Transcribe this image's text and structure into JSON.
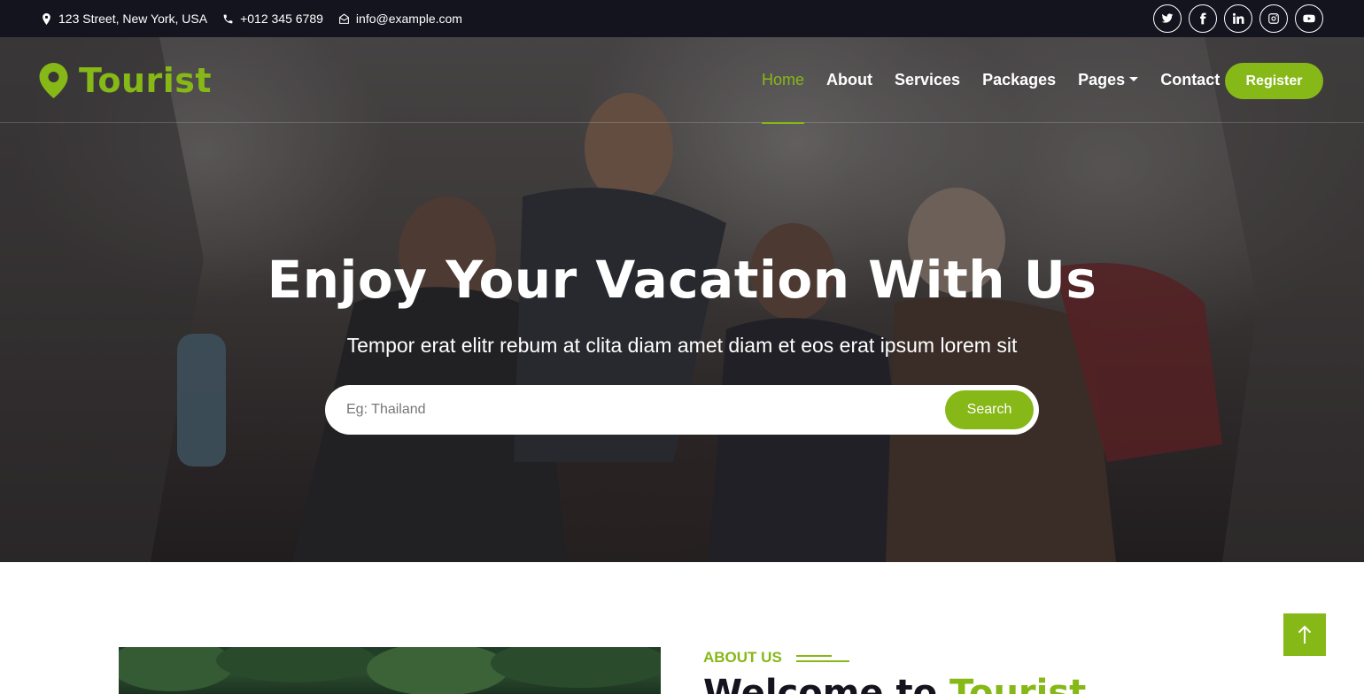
{
  "topbar": {
    "address": "123 Street, New York, USA",
    "phone": "+012 345 6789",
    "email": "info@example.com",
    "socials": [
      "twitter-icon",
      "facebook-icon",
      "linkedin-icon",
      "instagram-icon",
      "youtube-icon"
    ]
  },
  "brand": {
    "name": "Tourist",
    "icon": "map-marker-icon"
  },
  "nav": {
    "items": [
      {
        "label": "Home",
        "active": true
      },
      {
        "label": "About"
      },
      {
        "label": "Services"
      },
      {
        "label": "Packages"
      },
      {
        "label": "Pages",
        "dropdown": true
      },
      {
        "label": "Contact"
      }
    ],
    "register_label": "Register"
  },
  "hero": {
    "title": "Enjoy Your Vacation With Us",
    "subtitle": "Tempor erat elitr rebum at clita diam amet diam et eos erat ipsum lorem sit",
    "search_placeholder": "Eg: Thailand",
    "search_value": "",
    "search_button": "Search"
  },
  "about": {
    "label": "ABOUT US",
    "heading_prefix": "Welcome to ",
    "heading_accent": "Tourist"
  },
  "colors": {
    "accent": "#86b817",
    "dark": "#14141f"
  }
}
